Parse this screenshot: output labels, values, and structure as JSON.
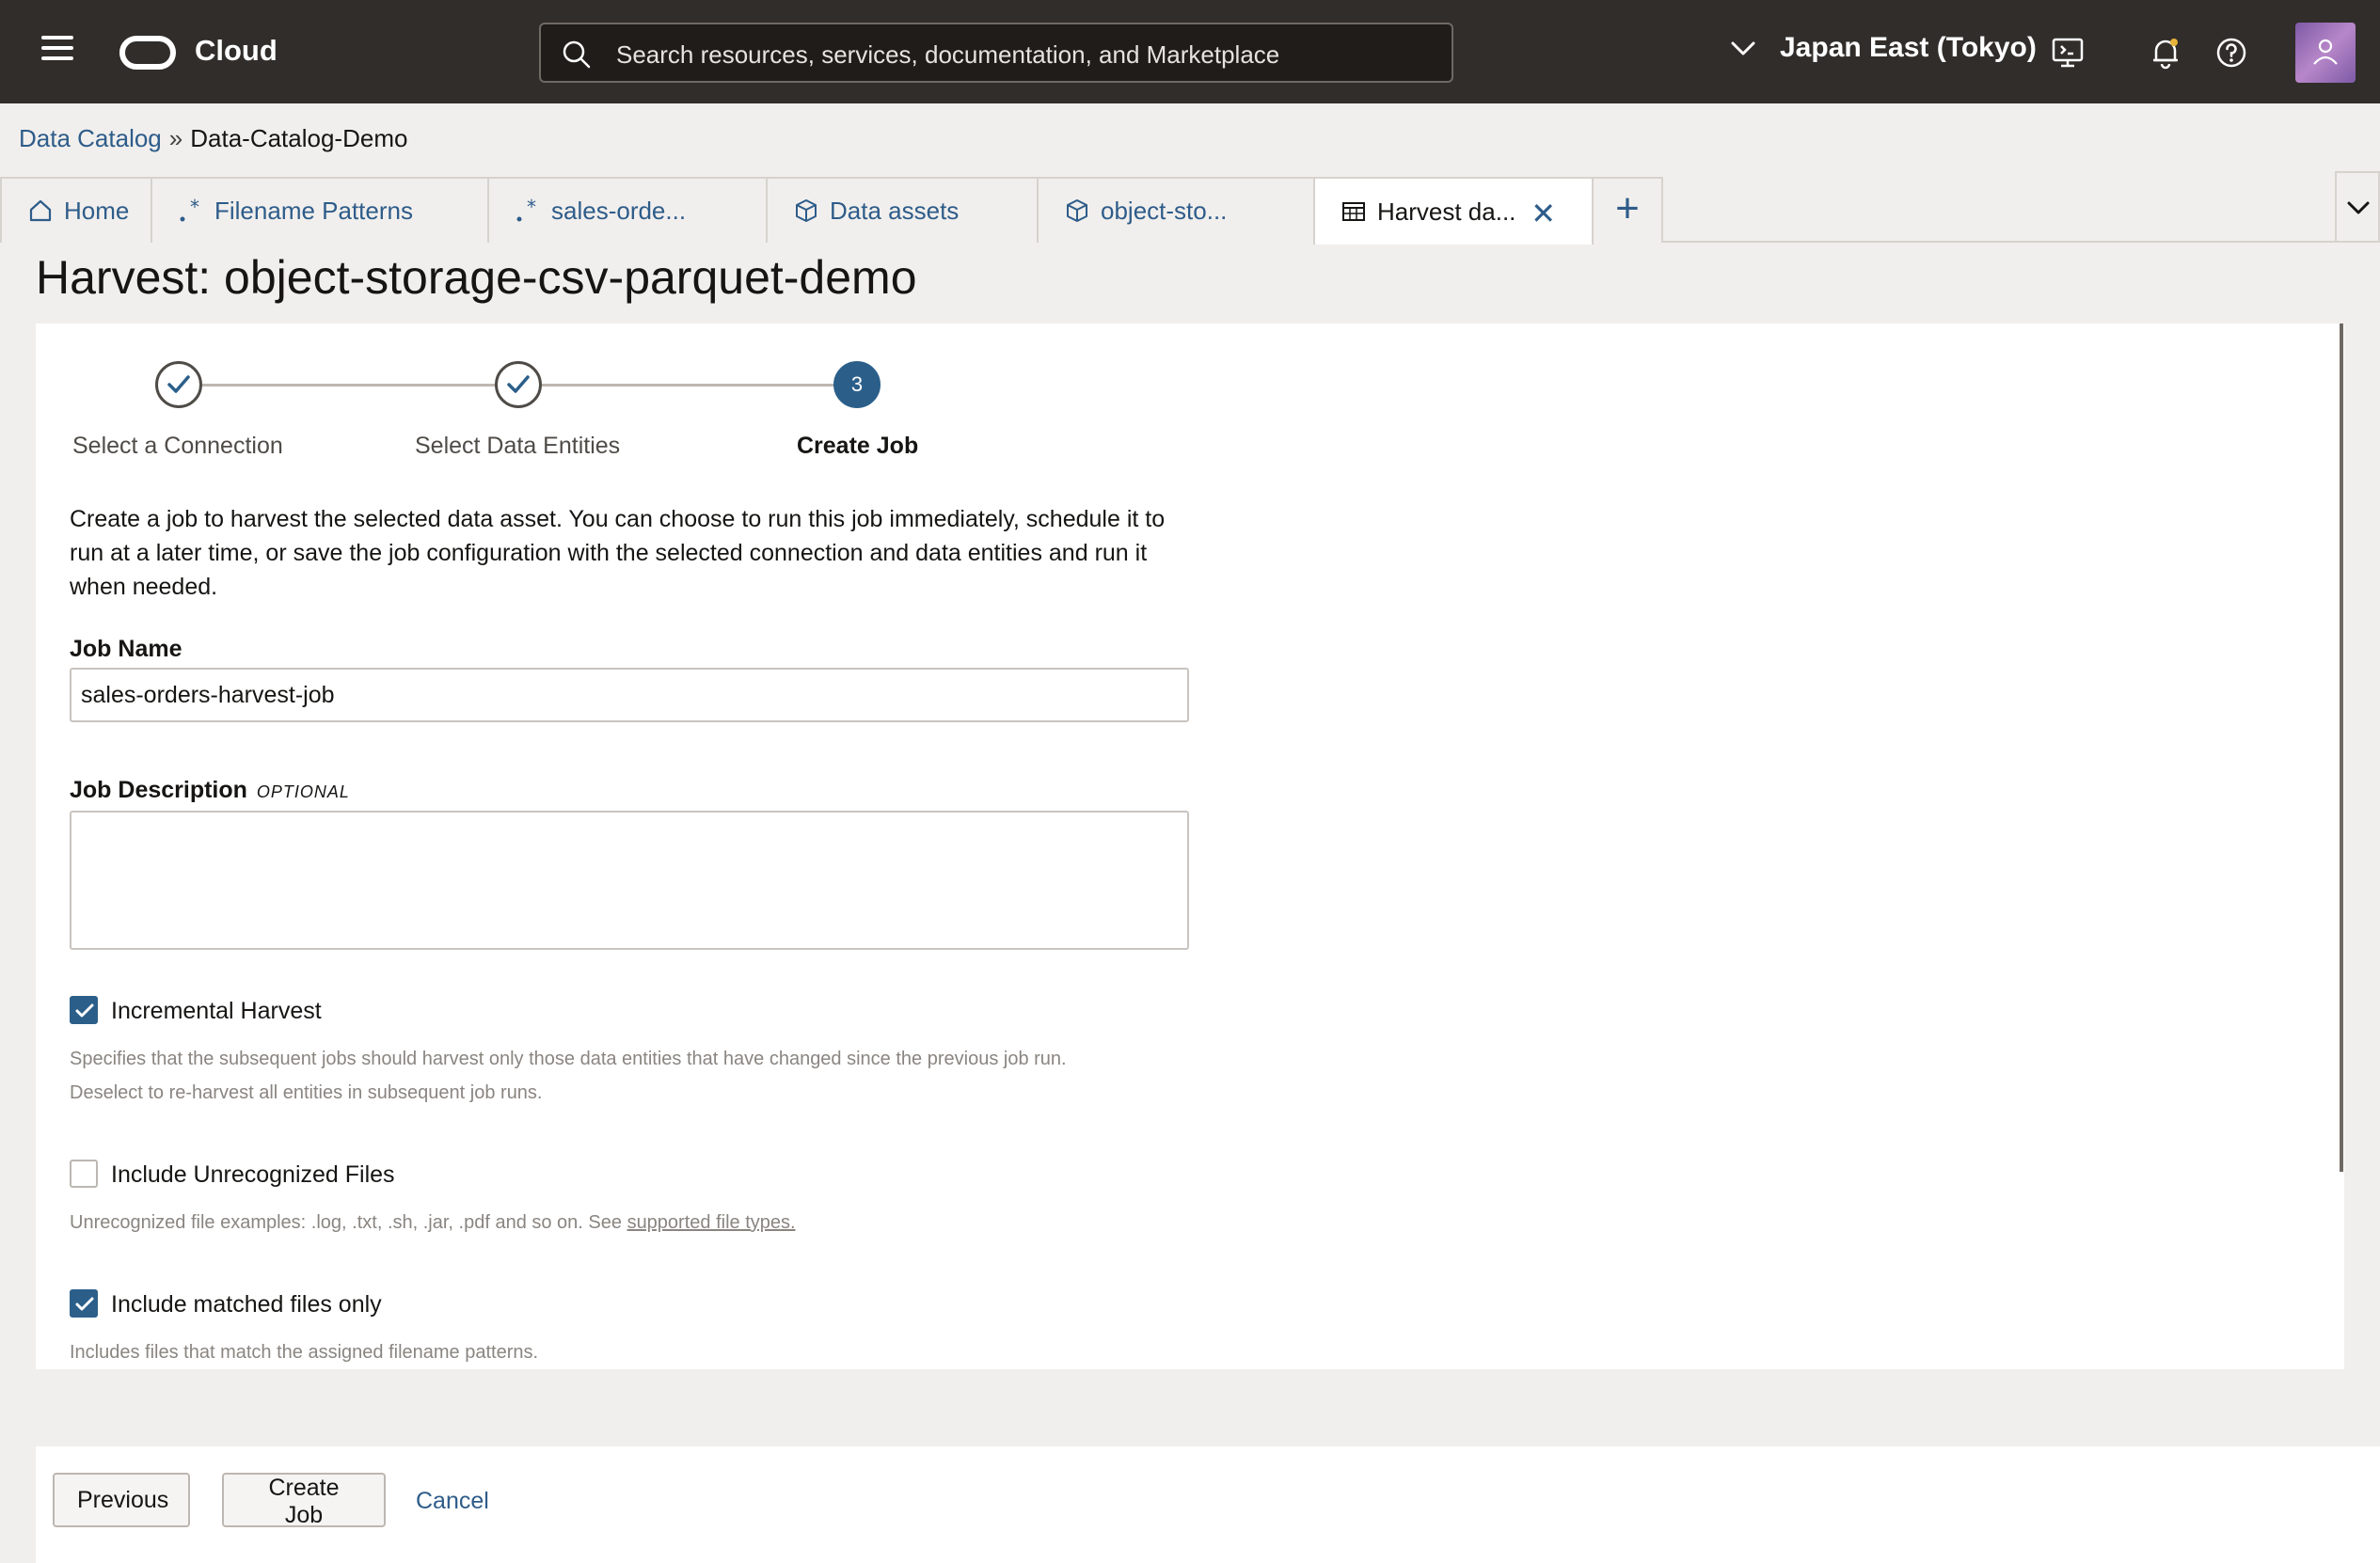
{
  "header": {
    "brand": "Cloud",
    "search_placeholder": "Search resources, services, documentation, and Marketplace",
    "region": "Japan East (Tokyo)"
  },
  "breadcrumb": {
    "root": "Data Catalog",
    "separator": "»",
    "current": "Data-Catalog-Demo"
  },
  "tabs": [
    {
      "label": "Home",
      "icon": "home-icon"
    },
    {
      "label": "Filename Patterns",
      "icon": "regex-icon"
    },
    {
      "label": "sales-orde...",
      "icon": "regex-icon"
    },
    {
      "label": "Data assets",
      "icon": "cube-icon"
    },
    {
      "label": "object-sto...",
      "icon": "cube-icon"
    },
    {
      "label": "Harvest da...",
      "icon": "table-icon",
      "active": true
    }
  ],
  "page_title": "Harvest: object-storage-csv-parquet-demo",
  "train": {
    "steps": [
      {
        "label": "Select a Connection",
        "state": "done"
      },
      {
        "label": "Select Data Entities",
        "state": "done"
      },
      {
        "label": "Create Job",
        "state": "current",
        "number": "3"
      }
    ]
  },
  "form": {
    "intro": "Create a job to harvest the selected data asset. You can choose to run this job immediately, schedule it to run at a later time, or save the job configuration with the selected connection and data entities and run it when needed.",
    "job_name_label": "Job Name",
    "job_name_value": "sales-orders-harvest-job",
    "job_description_label": "Job Description",
    "optional_tag": "OPTIONAL",
    "incremental": {
      "label": "Incremental Harvest",
      "checked": true,
      "help_line1": "Specifies that the subsequent jobs should harvest only those data entities that have changed since the previous job run.",
      "help_line2": "Deselect to re-harvest all entities in subsequent job runs."
    },
    "unrecognized": {
      "label": "Include Unrecognized Files",
      "checked": false,
      "help": "Unrecognized file examples: .log, .txt, .sh, .jar, .pdf and so on. See ",
      "help_link": "supported file types."
    },
    "matched": {
      "label": "Include matched files only",
      "checked": true,
      "help": "Includes files that match the assigned filename patterns."
    }
  },
  "footer": {
    "previous": "Previous",
    "create_job": "Create Job",
    "cancel": "Cancel"
  },
  "colors": {
    "topbar": "#312d2a",
    "accent": "#2b5f8a",
    "link": "#2e5c8a"
  }
}
